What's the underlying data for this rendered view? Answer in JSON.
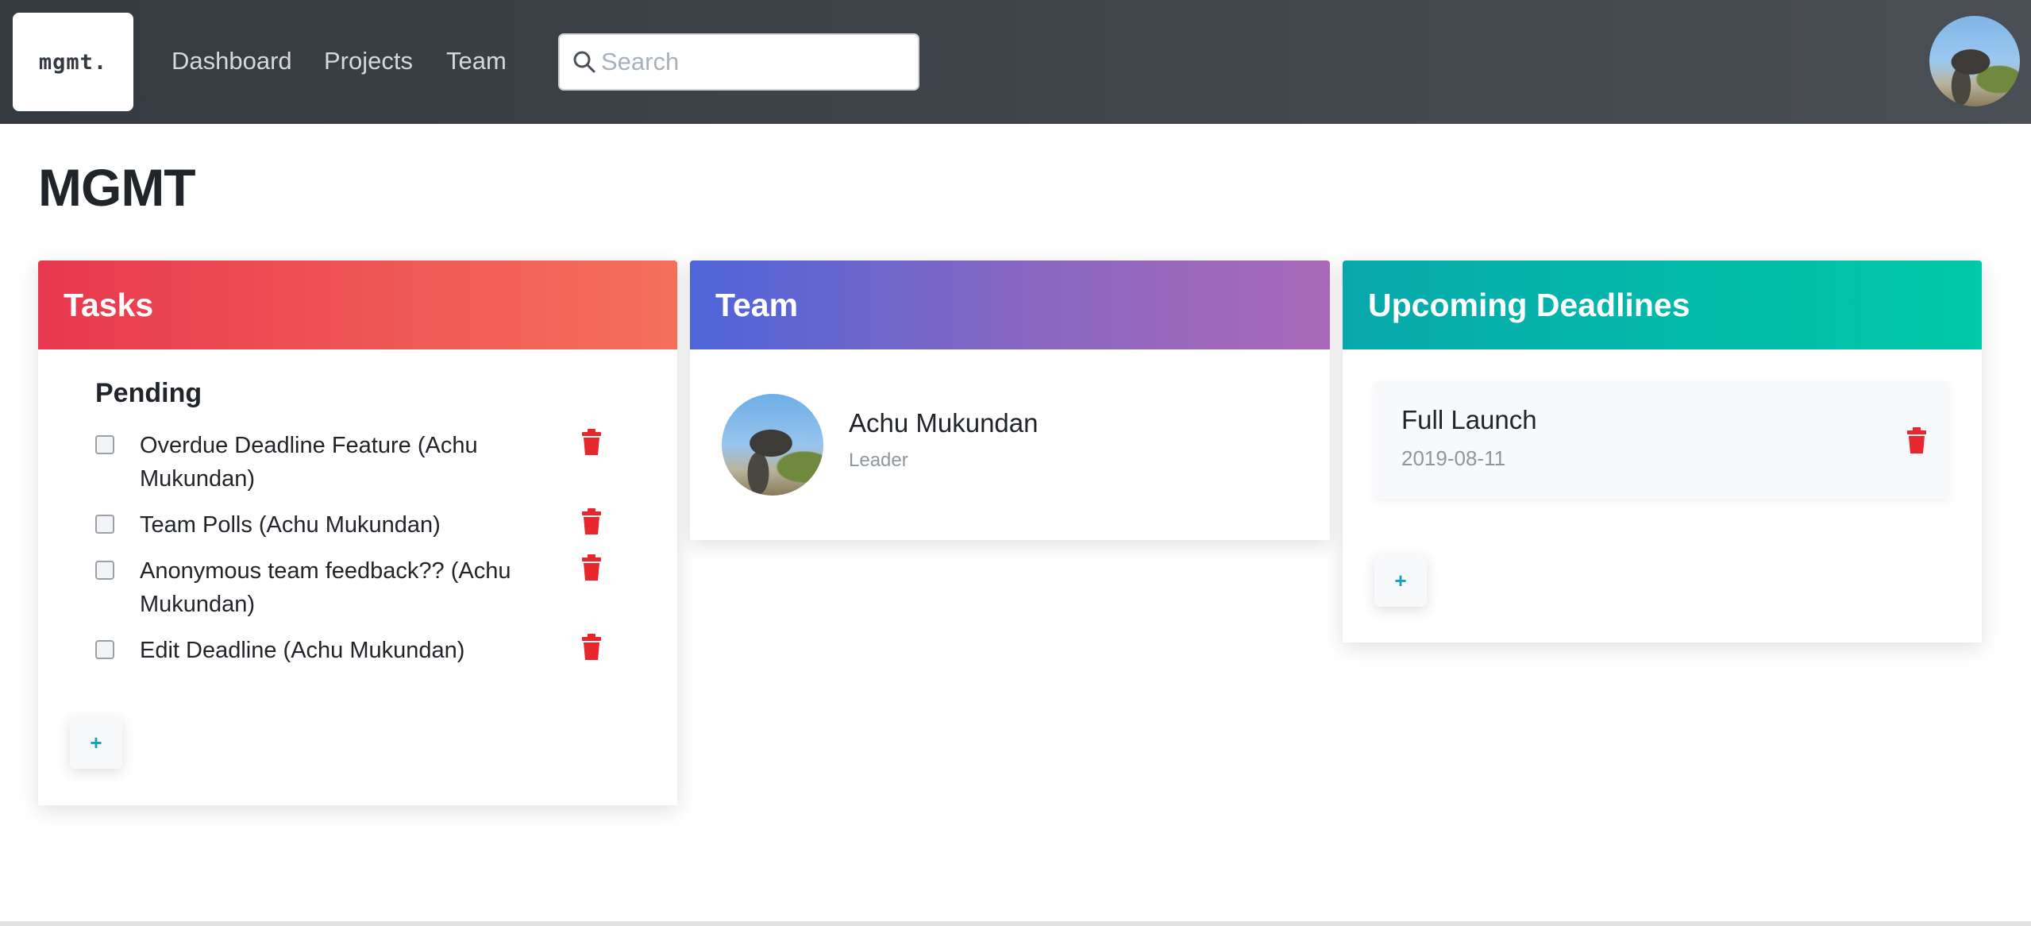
{
  "navbar": {
    "brand": "mgmt.",
    "links": [
      "Dashboard",
      "Projects",
      "Team"
    ],
    "search": {
      "placeholder": "Search",
      "value": ""
    },
    "user_avatar_icon": "user-avatar"
  },
  "page": {
    "title": "MGMT"
  },
  "tasks": {
    "header": "Tasks",
    "section": "Pending",
    "items": [
      {
        "text": "Overdue Deadline Feature (Achu Mukundan)",
        "checked": false
      },
      {
        "text": "Team Polls (Achu Mukundan)",
        "checked": false
      },
      {
        "text": "Anonymous team feedback?? (Achu Mukundan)",
        "checked": false
      },
      {
        "text": "Edit Deadline (Achu Mukundan)",
        "checked": false
      }
    ],
    "add_label": "+"
  },
  "team": {
    "header": "Team",
    "members": [
      {
        "name": "Achu Mukundan",
        "role": "Leader"
      }
    ]
  },
  "deadlines": {
    "header": "Upcoming Deadlines",
    "items": [
      {
        "name": "Full Launch",
        "date": "2019-08-11"
      }
    ],
    "add_label": "+"
  },
  "colors": {
    "tasks_gradient": [
      "#e8384f",
      "#f5705a"
    ],
    "team_gradient": [
      "#4e65d8",
      "#a96ab8"
    ],
    "deadlines_gradient": [
      "#07a8ab",
      "#00c9a7"
    ],
    "delete_red": "#e8262d",
    "add_accent": "#17a2b8"
  }
}
